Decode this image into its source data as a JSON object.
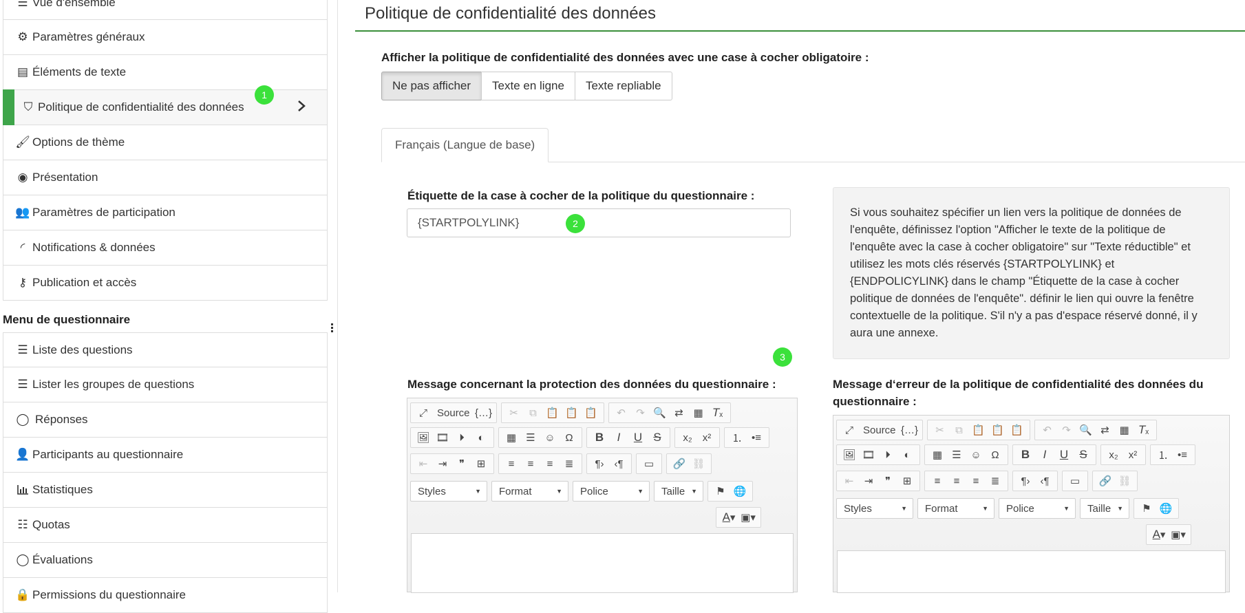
{
  "sidebar": {
    "top_partial_label": "Vue d'ensemble",
    "settings_items": [
      {
        "label": "Paramètres généraux",
        "icon": "cogs-icon"
      },
      {
        "label": "Éléments de texte",
        "icon": "file-text-icon"
      },
      {
        "label": "Politique de confidentialité des données",
        "icon": "shield-icon",
        "active": true
      },
      {
        "label": "Options de thème",
        "icon": "paintbrush-icon"
      },
      {
        "label": "Présentation",
        "icon": "eye-slash-icon"
      },
      {
        "label": "Paramètres de participation",
        "icon": "users-icon"
      },
      {
        "label": "Notifications & données",
        "icon": "rss-icon"
      },
      {
        "label": "Publication et accès",
        "icon": "key-icon"
      }
    ],
    "section_title": "Menu de questionnaire",
    "survey_items": [
      {
        "label": "Liste des questions",
        "icon": "list-icon"
      },
      {
        "label": "Lister les groupes de questions",
        "icon": "list-icon"
      },
      {
        "label": "Réponses",
        "icon": "comment-icon"
      },
      {
        "label": "Participants au questionnaire",
        "icon": "user-icon"
      },
      {
        "label": "Statistiques",
        "icon": "bar-chart-icon"
      },
      {
        "label": "Quotas",
        "icon": "tasks-icon"
      },
      {
        "label": "Évaluations",
        "icon": "comment-icon"
      },
      {
        "label": "Permissions du questionnaire",
        "icon": "lock-icon"
      }
    ],
    "markers": {
      "m1": "1"
    }
  },
  "main": {
    "page_title": "Politique de confidentialité des données",
    "option_label": "Afficher la politique de confidentialité des données avec une case à cocher obligatoire :",
    "options": [
      "Ne pas afficher",
      "Texte en ligne",
      "Texte repliable"
    ],
    "selected_option": "Ne pas afficher",
    "tab_label": "Français (Langue de base)",
    "checkbox_label_title": "Étiquette de la case à cocher de la politique du questionnaire :",
    "checkbox_label_value": "{STARTPOLYLINK}",
    "info_text": "Si vous souhaitez spécifier un lien vers la politique de données de l'enquête, définissez l'option \"Afficher le texte de la politique de l'enquête avec la case à cocher obligatoire\" sur \"Texte réductible\" et utilisez les mots clés réservés {STARTPOLYLINK} et {ENDPOLICYLINK} dans le champ \"Étiquette de la case à cocher politique de données de l'enquête\". définir le lien qui ouvre la fenêtre contextuelle de la politique. S'il n'y a pas d'espace réservé donné, il y aura une annexe.",
    "message_label": "Message concernant la protection des données du questionnaire :",
    "error_label": "Message d‘erreur de la politique de confidentialité des données du questionnaire :",
    "markers": {
      "m2": "2",
      "m3": "3"
    }
  },
  "editor": {
    "source_label": "Source",
    "combos": [
      "Styles",
      "Format",
      "Police",
      "Taille"
    ]
  },
  "colors": {
    "accent": "#3ea54a",
    "marker": "#3be13b",
    "rule": "#3a8f3a"
  }
}
